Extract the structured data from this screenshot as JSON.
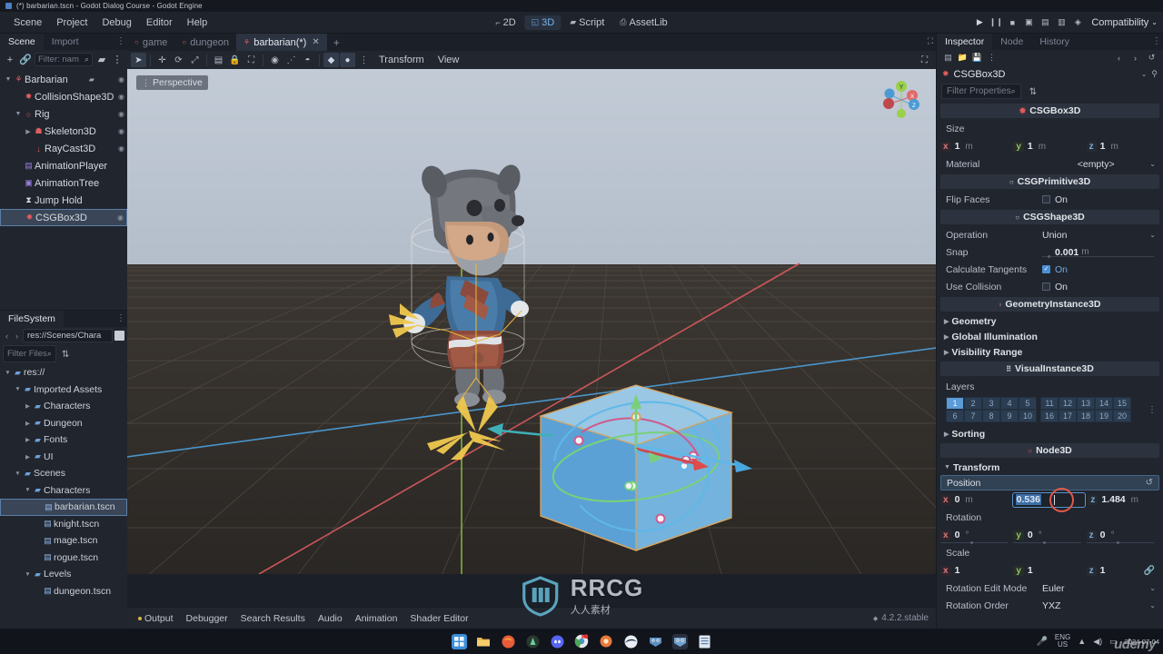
{
  "window": {
    "title": "(*) barbarian.tscn - Godot Dialog Course - Godot Engine"
  },
  "menu": {
    "items": [
      "Scene",
      "Project",
      "Debug",
      "Editor",
      "Help"
    ],
    "modes": [
      {
        "label": "2D",
        "icon": "2d-icon",
        "active": false
      },
      {
        "label": "3D",
        "icon": "3d-icon",
        "active": true
      },
      {
        "label": "Script",
        "icon": "script-icon",
        "active": false
      },
      {
        "label": "AssetLib",
        "icon": "assetlib-icon",
        "active": false
      }
    ],
    "run_tools": [
      "play-icon",
      "pause-icon",
      "stop-icon",
      "movie-icon",
      "play-scene-icon",
      "play-custom-icon",
      "remote-debug-icon"
    ],
    "renderer": "Compatibility"
  },
  "scene_panel": {
    "tabs": [
      {
        "label": "Scene",
        "active": true
      },
      {
        "label": "Import",
        "active": false
      }
    ],
    "toolbar": {
      "add_node": "+",
      "instantiate": "link-icon",
      "filter_placeholder": "Filter: nam",
      "search_icon": "search-icon",
      "script_icon": "script-icon",
      "menu_icon": "vertical-dots-icon"
    },
    "nodes": [
      {
        "label": "Barbarian",
        "indent": 0,
        "icon": "character-body-icon",
        "icon_color": "#e05c5c",
        "arrow": "down",
        "has_script": true,
        "visibility": true,
        "selected": false
      },
      {
        "label": "CollisionShape3D",
        "indent": 1,
        "icon": "collision-shape-icon",
        "icon_color": "#e05c5c",
        "arrow": "none",
        "has_script": false,
        "visibility": true,
        "selected": false
      },
      {
        "label": "Rig",
        "indent": 1,
        "icon": "node3d-icon",
        "icon_color": "#e05c5c",
        "arrow": "down",
        "has_script": false,
        "visibility": true,
        "selected": false
      },
      {
        "label": "Skeleton3D",
        "indent": 2,
        "icon": "skeleton-icon",
        "icon_color": "#e05c5c",
        "arrow": "right",
        "has_script": false,
        "visibility": true,
        "selected": false
      },
      {
        "label": "RayCast3D",
        "indent": 2,
        "icon": "raycast-icon",
        "icon_color": "#e05c5c",
        "arrow": "none",
        "has_script": false,
        "visibility": true,
        "selected": false
      },
      {
        "label": "AnimationPlayer",
        "indent": 1,
        "icon": "animation-player-icon",
        "icon_color": "#9b7ce0",
        "arrow": "none",
        "has_script": false,
        "visibility": false,
        "selected": false
      },
      {
        "label": "AnimationTree",
        "indent": 1,
        "icon": "animation-tree-icon",
        "icon_color": "#9b7ce0",
        "arrow": "none",
        "has_script": false,
        "visibility": false,
        "selected": false
      },
      {
        "label": "Jump Hold",
        "indent": 1,
        "icon": "timer-icon",
        "icon_color": "#d6dae2",
        "arrow": "none",
        "has_script": false,
        "visibility": false,
        "selected": false
      },
      {
        "label": "CSGBox3D",
        "indent": 1,
        "icon": "csg-box-icon",
        "icon_color": "#e05c5c",
        "arrow": "none",
        "has_script": false,
        "visibility": true,
        "selected": true
      }
    ]
  },
  "filesystem_panel": {
    "tab": "FileSystem",
    "path": "res://Scenes/Chara",
    "nav_back": "‹",
    "nav_forward": "›",
    "filter_placeholder": "Filter Files",
    "files": [
      {
        "label": "res://",
        "indent": 0,
        "type": "folder",
        "arrow": "down",
        "selected": false
      },
      {
        "label": "Imported Assets",
        "indent": 1,
        "type": "folder",
        "arrow": "down",
        "selected": false
      },
      {
        "label": "Characters",
        "indent": 2,
        "type": "folder",
        "arrow": "right",
        "selected": false
      },
      {
        "label": "Dungeon",
        "indent": 2,
        "type": "folder",
        "arrow": "right",
        "selected": false
      },
      {
        "label": "Fonts",
        "indent": 2,
        "type": "folder",
        "arrow": "right",
        "selected": false
      },
      {
        "label": "UI",
        "indent": 2,
        "type": "folder",
        "arrow": "right",
        "selected": false
      },
      {
        "label": "Scenes",
        "indent": 1,
        "type": "folder",
        "arrow": "down",
        "selected": false
      },
      {
        "label": "Characters",
        "indent": 2,
        "type": "folder",
        "arrow": "down",
        "selected": false
      },
      {
        "label": "barbarian.tscn",
        "indent": 3,
        "type": "scene",
        "arrow": "none",
        "selected": true
      },
      {
        "label": "knight.tscn",
        "indent": 3,
        "type": "scene",
        "arrow": "none",
        "selected": false
      },
      {
        "label": "mage.tscn",
        "indent": 3,
        "type": "scene",
        "arrow": "none",
        "selected": false
      },
      {
        "label": "rogue.tscn",
        "indent": 3,
        "type": "scene",
        "arrow": "none",
        "selected": false
      },
      {
        "label": "Levels",
        "indent": 2,
        "type": "folder",
        "arrow": "down",
        "selected": false
      },
      {
        "label": "dungeon.tscn",
        "indent": 3,
        "type": "scene",
        "arrow": "none",
        "selected": false
      }
    ]
  },
  "scene_tabs": [
    {
      "label": "game",
      "active": false,
      "modified": false
    },
    {
      "label": "dungeon",
      "active": false,
      "modified": false
    },
    {
      "label": "barbarian(*)",
      "active": true,
      "modified": true
    }
  ],
  "viewport": {
    "toolbar_icons": [
      "select-mode-icon",
      "move-mode-icon",
      "rotate-mode-icon",
      "scale-mode-icon",
      "list-select-icon",
      "lock-icon",
      "group-icon",
      "ruler-icon",
      "snap-icon",
      "local-space-icon",
      "snap-magnet-icon",
      "camera-preview-icon",
      "options-dots-icon"
    ],
    "menus": [
      "Transform",
      "View"
    ],
    "label": "Perspective",
    "gizmo_axes": [
      "X",
      "Y",
      "Z"
    ],
    "expand_icon": "expand-viewport-icon"
  },
  "bottom_panel": {
    "tabs": [
      "Output",
      "Debugger",
      "Search Results",
      "Audio",
      "Animation",
      "Shader Editor"
    ],
    "version": "4.2.2.stable"
  },
  "inspector": {
    "tabs": [
      {
        "label": "Inspector",
        "active": true
      },
      {
        "label": "Node",
        "active": false
      },
      {
        "label": "History",
        "active": false
      }
    ],
    "toolbar_icons": [
      "new-resource-icon",
      "load-resource-icon",
      "save-resource-icon",
      "resource-menu-icon"
    ],
    "nav_icons": [
      "back-icon",
      "forward-icon",
      "history-icon"
    ],
    "selected_node": "CSGBox3D",
    "selected_node_icon": "csg-box-icon",
    "open-docs-icon": "open-docs-icon",
    "filter_placeholder": "Filter Properties",
    "sections": [
      {
        "kind": "category",
        "label": "CSGBox3D",
        "icon": "csg-box-icon",
        "icon_color": "#e05c5c"
      },
      {
        "kind": "label",
        "label": "Size"
      },
      {
        "kind": "vec3",
        "name": "size",
        "x": "1",
        "y": "1",
        "z": "1",
        "unit": "m"
      },
      {
        "kind": "dropdown",
        "label": "Material",
        "value": "<empty>"
      },
      {
        "kind": "category",
        "label": "CSGPrimitive3D",
        "icon": "csg-primitive-icon",
        "icon_color": "#d8dce4"
      },
      {
        "kind": "checkbox",
        "label": "Flip Faces",
        "value": "On",
        "checked": false
      },
      {
        "kind": "category",
        "label": "CSGShape3D",
        "icon": "csg-shape-icon",
        "icon_color": "#d8dce4"
      },
      {
        "kind": "dropdown",
        "label": "Operation",
        "value": "Union"
      },
      {
        "kind": "snap",
        "label": "Snap",
        "value": "0.001",
        "unit": "m"
      },
      {
        "kind": "checkbox",
        "label": "Calculate Tangents",
        "value": "On",
        "checked": true
      },
      {
        "kind": "checkbox",
        "label": "Use Collision",
        "value": "On",
        "checked": false
      },
      {
        "kind": "category",
        "label": "GeometryInstance3D",
        "icon": "geometry-instance-icon",
        "icon_color": "#d88a8a"
      },
      {
        "kind": "subhead",
        "label": "Geometry"
      },
      {
        "kind": "subhead",
        "label": "Global Illumination"
      },
      {
        "kind": "subhead",
        "label": "Visibility Range"
      },
      {
        "kind": "category",
        "label": "VisualInstance3D",
        "icon": "visual-instance-icon",
        "icon_color": "#d8dce4"
      },
      {
        "kind": "label",
        "label": "Layers"
      },
      {
        "kind": "layers"
      },
      {
        "kind": "subhead",
        "label": "Sorting"
      },
      {
        "kind": "category",
        "label": "Node3D",
        "icon": "node3d-icon",
        "icon_color": "#e05c5c"
      },
      {
        "kind": "subhead",
        "label": "Transform",
        "expanded": true
      }
    ],
    "layers": {
      "left_block": [
        [
          {
            "n": "1",
            "on": true
          },
          {
            "n": "2",
            "on": false
          },
          {
            "n": "3",
            "on": false
          },
          {
            "n": "4",
            "on": false
          },
          {
            "n": "5",
            "on": false
          }
        ],
        [
          {
            "n": "6",
            "on": false
          },
          {
            "n": "7",
            "on": false
          },
          {
            "n": "8",
            "on": false
          },
          {
            "n": "9",
            "on": false
          },
          {
            "n": "10",
            "on": false
          }
        ]
      ],
      "right_block": [
        [
          {
            "n": "11",
            "on": false
          },
          {
            "n": "12",
            "on": false
          },
          {
            "n": "13",
            "on": false
          },
          {
            "n": "14",
            "on": false
          },
          {
            "n": "15",
            "on": false
          }
        ],
        [
          {
            "n": "16",
            "on": false
          },
          {
            "n": "17",
            "on": false
          },
          {
            "n": "18",
            "on": false
          },
          {
            "n": "19",
            "on": false
          },
          {
            "n": "20",
            "on": false
          }
        ]
      ]
    },
    "transform": {
      "position_label": "Position",
      "position": {
        "x": "0",
        "y": "0.536",
        "z": "1.484",
        "unit": "m",
        "focused_axis": "y"
      },
      "rotation_label": "Rotation",
      "rotation": {
        "x": "0",
        "y": "0",
        "z": "0",
        "unit": "°"
      },
      "scale_label": "Scale",
      "scale": {
        "x": "1",
        "y": "1",
        "z": "1",
        "unit": ""
      },
      "rotation_edit_mode": {
        "label": "Rotation Edit Mode",
        "value": "Euler"
      },
      "rotation_order": {
        "label": "Rotation Order",
        "value": "YXZ"
      }
    }
  },
  "taskbar": {
    "icons": [
      "windows-start-icon",
      "file-explorer-icon",
      "firefox-icon",
      "browser-icon",
      "discord-icon",
      "chrome-icon",
      "update-icon",
      "edge-icon",
      "godot-icon",
      "godot-active-icon",
      "notes-icon"
    ],
    "tray": {
      "mic_icon": "microphone-icon",
      "language": "ENG",
      "region": "US",
      "wifi_icon": "wifi-icon",
      "volume_icon": "volume-icon",
      "network_icon": "network-icon",
      "date": "2024-07-04"
    }
  },
  "watermark": {
    "brand": "RRCG",
    "sub": "人人素材",
    "udemy": "udemy"
  },
  "colors": {
    "accent": "#5a9bd8",
    "selection": "#3a4657",
    "panel_bg": "#21252e",
    "dark_bg": "#1b1f27",
    "axis_x": "#d67b7b",
    "axis_y": "#8fc06a",
    "axis_z": "#7aa8d8"
  }
}
